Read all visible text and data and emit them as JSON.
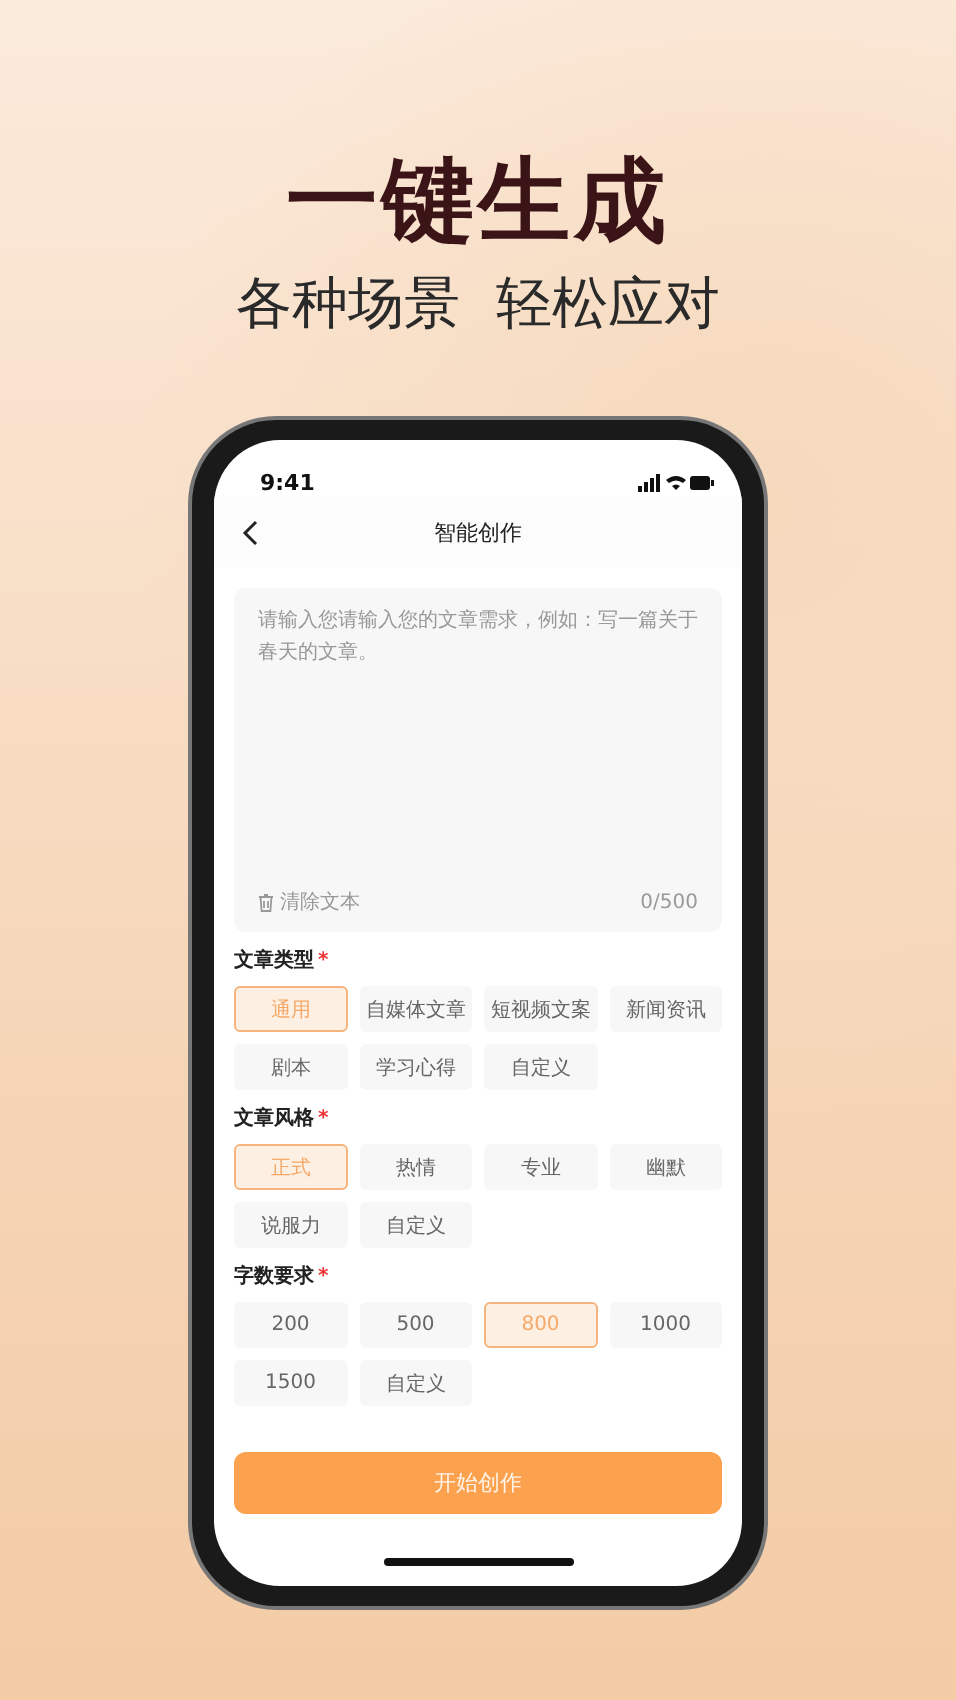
{
  "headline": "一键生成",
  "subtitle": "各种场景  轻松应对",
  "phone": {
    "status_bar": {
      "time": "9:41"
    },
    "nav": {
      "title": "智能创作"
    },
    "text_area": {
      "placeholder": "请输入您请输入您的文章需求，例如：写一篇关于春天的文章。",
      "clear_label": "清除文本",
      "counter": "0/500"
    },
    "sections": [
      {
        "label": "文章类型",
        "marker": "*",
        "options": [
          {
            "label": "通用",
            "selected": true
          },
          {
            "label": "自媒体文章",
            "selected": false
          },
          {
            "label": "短视频文案",
            "selected": false
          },
          {
            "label": "新闻资讯",
            "selected": false
          },
          {
            "label": "剧本",
            "selected": false
          },
          {
            "label": "学习心得",
            "selected": false
          },
          {
            "label": "自定义",
            "selected": false
          }
        ]
      },
      {
        "label": "文章风格",
        "marker": "*",
        "options": [
          {
            "label": "正式",
            "selected": true
          },
          {
            "label": "热情",
            "selected": false
          },
          {
            "label": "专业",
            "selected": false
          },
          {
            "label": "幽默",
            "selected": false
          },
          {
            "label": "说服力",
            "selected": false
          },
          {
            "label": "自定义",
            "selected": false
          }
        ]
      },
      {
        "label": "字数要求",
        "marker": "*",
        "options": [
          {
            "label": "200",
            "selected": false
          },
          {
            "label": "500",
            "selected": false
          },
          {
            "label": "800",
            "selected": true
          },
          {
            "label": "1000",
            "selected": false
          },
          {
            "label": "1500",
            "selected": false
          },
          {
            "label": "自定义",
            "selected": false
          }
        ]
      }
    ],
    "button": "开始创作"
  }
}
